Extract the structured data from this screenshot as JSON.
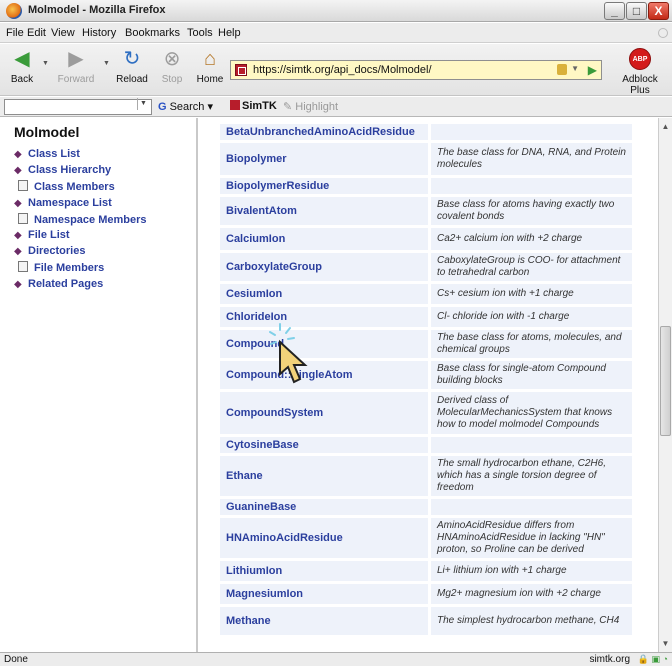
{
  "window": {
    "title": "Molmodel - Mozilla Firefox",
    "buttons": {
      "minimize": "_",
      "maximize": "□",
      "close": "X"
    }
  },
  "menu": [
    "File",
    "Edit",
    "View",
    "History",
    "Bookmarks",
    "Tools",
    "Help"
  ],
  "nav": {
    "back": "Back",
    "forward": "Forward",
    "reload": "Reload",
    "stop": "Stop",
    "home": "Home",
    "url": "https://simtk.org/api_docs/Molmodel/",
    "adblock": "Adblock Plus",
    "adblock_icon_text": "ABP"
  },
  "searchbar": {
    "search_value": "",
    "search_label": "Search",
    "simtk_label": "SimTK",
    "highlight_label": "Highlight"
  },
  "sidebar": {
    "title": "Molmodel",
    "items": [
      {
        "label": "Class List",
        "kind": "folder"
      },
      {
        "label": "Class Hierarchy",
        "kind": "folder"
      },
      {
        "label": "Class Members",
        "kind": "doc"
      },
      {
        "label": "Namespace List",
        "kind": "folder"
      },
      {
        "label": "Namespace Members",
        "kind": "doc"
      },
      {
        "label": "File List",
        "kind": "folder"
      },
      {
        "label": "Directories",
        "kind": "folder"
      },
      {
        "label": "File Members",
        "kind": "doc"
      },
      {
        "label": "Related Pages",
        "kind": "folder"
      }
    ]
  },
  "classes": [
    {
      "name": "BetaUnbranchedAminoAcidResidue",
      "desc": ""
    },
    {
      "name": "Biopolymer",
      "desc": "The base class for DNA, RNA, and Protein molecules"
    },
    {
      "name": "BiopolymerResidue",
      "desc": ""
    },
    {
      "name": "BivalentAtom",
      "desc": "Base class for atoms having exactly two covalent bonds"
    },
    {
      "name": "CalciumIon",
      "desc": "Ca2+ calcium ion with +2 charge"
    },
    {
      "name": "CarboxylateGroup",
      "desc": "CaboxylateGroup is COO- for attachment to tetrahedral carbon"
    },
    {
      "name": "CesiumIon",
      "desc": "Cs+ cesium ion with +1 charge"
    },
    {
      "name": "ChlorideIon",
      "desc": "Cl- chloride ion with -1 charge"
    },
    {
      "name": "Compound",
      "desc": "The base class for atoms, molecules, and chemical groups"
    },
    {
      "name": "Compound::SingleAtom",
      "desc": "Base class for single-atom Compound building blocks"
    },
    {
      "name": "CompoundSystem",
      "desc": "Derived class of MolecularMechanicsSystem that knows how to model molmodel Compounds"
    },
    {
      "name": "CytosineBase",
      "desc": ""
    },
    {
      "name": "Ethane",
      "desc": "The small hydrocarbon ethane, C2H6, which has a single torsion degree of freedom"
    },
    {
      "name": "GuanineBase",
      "desc": ""
    },
    {
      "name": "HNAminoAcidResidue",
      "desc": "AminoAcidResidue differs from HNAminoAcidResidue in lacking \"HN\" proton, so Proline can be derived"
    },
    {
      "name": "LithiumIon",
      "desc": "Li+ lithium ion with +1 charge"
    },
    {
      "name": "MagnesiumIon",
      "desc": "Mg2+ magnesium ion with +2 charge"
    },
    {
      "name": "Methane",
      "desc": "The simplest hydrocarbon methane, CH4"
    }
  ],
  "status": {
    "text": "Done",
    "host": "simtk.org"
  }
}
